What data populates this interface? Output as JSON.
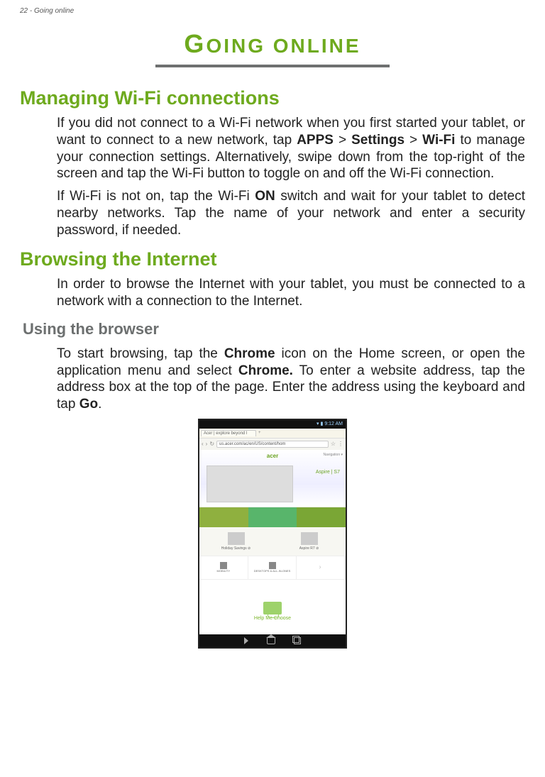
{
  "header": {
    "line": "22 - Going online"
  },
  "chapter": {
    "title_part1": "G",
    "title_part2": "OING ONLINE"
  },
  "sections": {
    "wifi": {
      "heading": "Managing Wi-Fi connections",
      "p1_a": "If you did not connect to a Wi-Fi network when you first started your tablet, or want to connect to a new network, tap ",
      "p1_b1": "APPS",
      "p1_gt1": " > ",
      "p1_b2": "Settings",
      "p1_gt2": " > ",
      "p1_b3": "Wi-Fi",
      "p1_c": " to manage your connection settings. Alternatively, swipe down from the top-right of the screen and tap the Wi-Fi button to toggle on and off the Wi-Fi connection.",
      "p2_a": "If Wi-Fi is not on, tap the Wi-Fi ",
      "p2_b1": "ON",
      "p2_b": " switch and wait for your tablet to detect nearby networks. Tap the name of your network and enter a security password, if needed."
    },
    "browse": {
      "heading": "Browsing the Internet",
      "p1": "In order to browse the Internet with your tablet, you must be connected to a network with a connection to the Internet."
    },
    "using": {
      "heading": "Using the browser",
      "p1_a": "To start browsing, tap the ",
      "p1_b1": "Chrome",
      "p1_b": " icon on the Home screen, or open the application menu and select ",
      "p1_b2": "Chrome.",
      "p1_c": " To enter a website address, tap the address box at the top of the page. Enter the address using the keyboard and tap ",
      "p1_b3": "Go",
      "p1_d": "."
    }
  },
  "screenshot": {
    "statusbar_time": "9:12 AM",
    "tab_title": "Acer | explore beyond l",
    "url": "us.acer.com/ac/en/US/content/hom",
    "logo": "acer",
    "nav": "Navigation ▾",
    "promo_text": "Aspire | S7",
    "tiles": {
      "t1": "",
      "t2": "",
      "t3": ""
    },
    "prod1": "Holiday Savings",
    "prod1_badge": "⊘",
    "prod2": "Aspire R7",
    "prod2_badge": "⊘",
    "cat1": "MOBILITY",
    "cat2": "DESKTOPS & ALL-IN-ONES",
    "help": "Help Me Choose"
  }
}
